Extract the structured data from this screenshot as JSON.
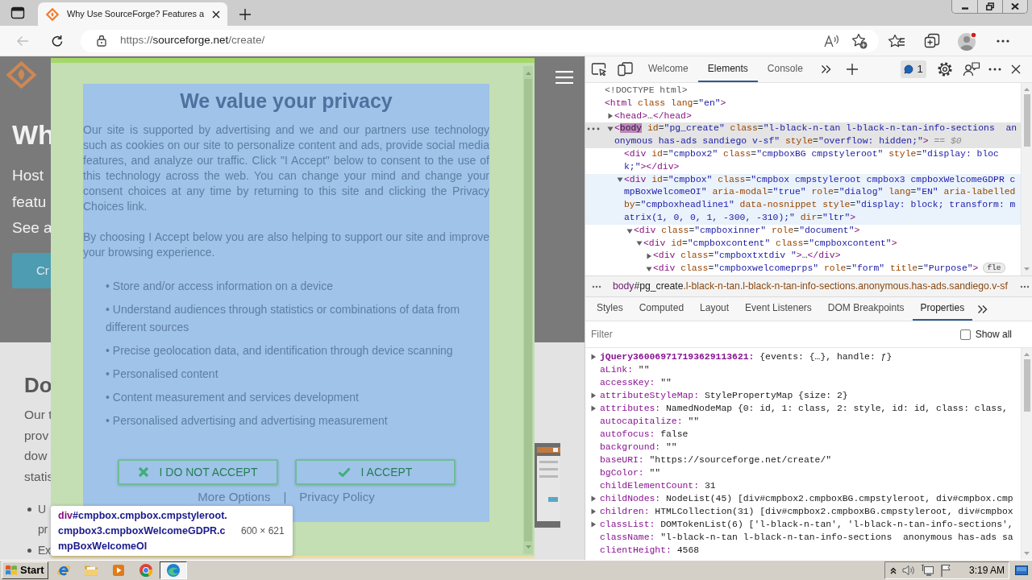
{
  "browser": {
    "tabs": [
      {
        "title": "Why Use SourceForge? Features a",
        "selected": true
      }
    ],
    "back_button": {
      "disabled": true
    },
    "address": {
      "scheme": "https://",
      "host": "sourceforge.net",
      "path": "/create/"
    }
  },
  "page": {
    "heading": "Wh",
    "intro_lines": [
      "Host",
      "featu",
      "See a"
    ],
    "primary_button": "Cr",
    "section_heading": "Do",
    "section_lines": [
      "Our t",
      "prov",
      "dow",
      "statis"
    ],
    "section_bullets": [
      {
        "fragments": [
          "U",
          "pr"
        ]
      },
      {
        "fragments": [
          "Ex"
        ]
      }
    ]
  },
  "consent_dialog": {
    "title": "We value your privacy",
    "paragraphs": [
      "Our site is supported by advertising and we and our partners use technology such as cookies on our site to personalize content and ads, provide social media features, and analyze our traffic. Click \"I Accept\" below to consent to the use of this technology across the web. You can change your mind and change your consent choices at any time by returning to this site and clicking the Privacy Choices link.",
      "By choosing I Accept below you are also helping to support our site and improve your browsing experience."
    ],
    "purposes": [
      "• Store and/or access information on a device",
      "• Understand audiences through statistics or combinations of data from different sources",
      "• Precise geolocation data, and identification through device scanning",
      "• Personalised content",
      "• Content measurement and services development",
      "• Personalised advertising and advertising measurement"
    ],
    "buttons": [
      {
        "kind": "reject",
        "label": "I DO NOT ACCEPT"
      },
      {
        "kind": "accept",
        "label": "I ACCEPT"
      }
    ],
    "links": [
      "More Options",
      "Privacy Policy"
    ],
    "link_separator": "|"
  },
  "inspect_tooltip": {
    "tag": "div",
    "selector": "#cmpbox.cmpbox.cmpstyleroot.cmpbox3.cmpboxWelcomeGDPR.cmpBoxWelcomeOI",
    "size": "600 × 621"
  },
  "devtools": {
    "tabs": [
      {
        "label": "Welcome",
        "selected": false
      },
      {
        "label": "Elements",
        "selected": true
      },
      {
        "label": "Console",
        "selected": false
      }
    ],
    "issues_count": "1",
    "dom_tree": [
      {
        "text": "<!DOCTYPE html>",
        "selected": false,
        "hovered": false
      },
      {
        "text": "<html class lang=\"en\">",
        "selected": false,
        "hovered": false,
        "children": [
          {
            "text": "<head>…</head>",
            "expanded": false,
            "selected": false,
            "hovered": false
          },
          {
            "text": "<body id=\"pg_create\" class=\"l-black-n-tan l-black-n-tan-info-sections  anonymous has-ads sandiego v-sf\" style=\"overflow: hidden;\">",
            "note": "== $0",
            "expanded": true,
            "selected": true,
            "hovered": false,
            "children": [
              {
                "text": "<div id=\"cmpbox2\" class=\"cmpboxBG cmpstyleroot\" style=\"display: block;\"></div>",
                "selected": false,
                "hovered": false
              },
              {
                "text": "<div id=\"cmpbox\" class=\"cmpbox cmpstyleroot cmpbox3 cmpboxWelcomeGDPR cmpBoxWelcomeOI\" aria-modal=\"true\" role=\"dialog\" lang=\"EN\" aria-labelledby=\"cmpboxheadline1\" data-nosnippet style=\"display: block; transform: matrix(1, 0, 0, 1, -300, -310);\" dir=\"ltr\">",
                "expanded": true,
                "selected": false,
                "hovered": true,
                "children": [
                  {
                    "text": "<div class=\"cmpboxinner\" role=\"document\">",
                    "expanded": true,
                    "selected": false,
                    "hovered": false,
                    "children": [
                      {
                        "text": "<div id=\"cmpboxcontent\" class=\"cmpboxcontent\">",
                        "expanded": true,
                        "selected": false,
                        "hovered": false,
                        "children": [
                          {
                            "text": "<div class=\"cmpboxtxtdiv \">…</div>",
                            "expanded": false,
                            "selected": false,
                            "hovered": false
                          },
                          {
                            "text": "<div class=\"cmpboxwelcomeprps\" role=\"form\" title=\"Purpose\">",
                            "badge": "fle",
                            "expanded": true,
                            "selected": false,
                            "hovered": false
                          }
                        ]
                      }
                    ]
                  }
                ]
              }
            ]
          }
        ]
      }
    ],
    "breadcrumb": {
      "tag": "body",
      "id": "#pg_create",
      "classes": ".l-black-n-tan.l-black-n-tan-info-sections.anonymous.has-ads.sandiego.v-sf"
    },
    "panel_tabs": [
      {
        "label": "Styles",
        "selected": false
      },
      {
        "label": "Computed",
        "selected": false
      },
      {
        "label": "Layout",
        "selected": false
      },
      {
        "label": "Event Listeners",
        "selected": false
      },
      {
        "label": "DOM Breakpoints",
        "selected": false
      },
      {
        "label": "Properties",
        "selected": true
      }
    ],
    "filter": {
      "placeholder": "Filter"
    },
    "show_all": {
      "label": "Show all",
      "checked": false
    },
    "properties": [
      {
        "text": "jQuery360069717193629113621: {events: {…}, handle: ƒ}",
        "own": true,
        "expanded": false
      },
      {
        "text": "aLink: \"\"",
        "own": false
      },
      {
        "text": "accessKey: \"\"",
        "own": false
      },
      {
        "text": "attributeStyleMap: StylePropertyMap {size: 2}",
        "own": false,
        "expanded": false
      },
      {
        "text": "attributes: NamedNodeMap {0: id, 1: class, 2: style, id: id, class: class,",
        "own": false,
        "expanded": false
      },
      {
        "text": "autocapitalize: \"\"",
        "own": false
      },
      {
        "text": "autofocus: false",
        "own": false
      },
      {
        "text": "background: \"\"",
        "own": false
      },
      {
        "text": "baseURI: \"https://sourceforge.net/create/\"",
        "own": false
      },
      {
        "text": "bgColor: \"\"",
        "own": false
      },
      {
        "text": "childElementCount: 31",
        "own": false
      },
      {
        "text": "childNodes: NodeList(45) [div#cmpbox2.cmpboxBG.cmpstyleroot, div#cmpbox.cmp",
        "own": false,
        "expanded": false
      },
      {
        "text": "children: HTMLCollection(31) [div#cmpbox2.cmpboxBG.cmpstyleroot, div#cmpbox",
        "own": false,
        "expanded": false
      },
      {
        "text": "classList: DOMTokenList(6) ['l-black-n-tan', 'l-black-n-tan-info-sections',",
        "own": false,
        "expanded": false
      },
      {
        "text": "className: \"l-black-n-tan l-black-n-tan-info-sections  anonymous has-ads sa",
        "own": false
      },
      {
        "text": "clientHeight: 4568",
        "own": false
      }
    ]
  },
  "taskbar": {
    "start": "Start",
    "apps": [
      {
        "kind": "globe",
        "active": false
      },
      {
        "kind": "folder",
        "active": false
      },
      {
        "kind": "player",
        "active": false
      },
      {
        "kind": "ring",
        "active": false
      },
      {
        "kind": "swirl",
        "active": true
      }
    ],
    "clock": "3:19 AM"
  }
}
